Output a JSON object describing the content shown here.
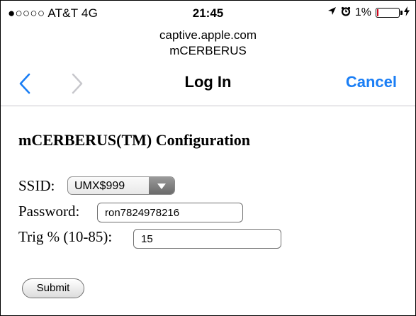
{
  "status_bar": {
    "signal": "●○○○○ AT&T  4G",
    "time": "21:45",
    "battery_percent": "1%",
    "battery_level": 0.04,
    "icons": [
      "location-arrow-icon",
      "alarm-clock-icon",
      "battery-icon",
      "charging-bolt-icon"
    ]
  },
  "url_bar": {
    "host": "captive.apple.com",
    "page_title": "mCERBERUS"
  },
  "navbar": {
    "title": "Log In",
    "cancel_label": "Cancel",
    "accent_color": "#1a7ef5"
  },
  "form": {
    "heading": "mCERBERUS(TM) Configuration",
    "ssid_label": "SSID:",
    "ssid_value": "UMX$999",
    "password_label": "Password:",
    "password_value": "ron7824978216",
    "trig_label": "Trig % (10-85):",
    "trig_value": "15",
    "submit_label": "Submit"
  }
}
